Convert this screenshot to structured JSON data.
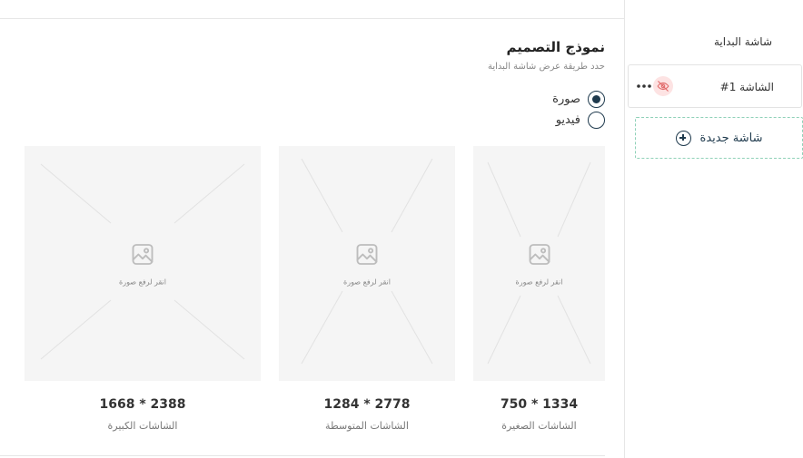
{
  "sidebar": {
    "title": "شاشة البداية",
    "screens": [
      {
        "label": "الشاشة 1#",
        "status_icon": "eye-off-icon",
        "menu_icon": "more-horizontal-icon"
      }
    ],
    "new_screen_label": "شاشة جديدة"
  },
  "design": {
    "title": "نموذج التصميم",
    "subtitle": "حدد طريقة عرض شاشة البداية",
    "options": [
      {
        "label": "صورة",
        "selected": true
      },
      {
        "label": "فيديو",
        "selected": false
      }
    ]
  },
  "uploads": [
    {
      "hint": "انقر لرفع صورة",
      "dimensions": "750 * 1334",
      "caption": "الشاشات الصغيرة"
    },
    {
      "hint": "انقر لرفع صورة",
      "dimensions": "1284 * 2778",
      "caption": "الشاشات المتوسطة"
    },
    {
      "hint": "انقر لرفع صورة",
      "dimensions": "1668 * 2388",
      "caption": "الشاشات الكبيرة"
    }
  ],
  "colors": {
    "primary": "#1f3a4d",
    "accent_dashed": "#8fd1b8",
    "hidden_badge": "#fde3e3",
    "hidden_icon": "#e26d6d",
    "placeholder_bg": "#f5f5f5"
  }
}
